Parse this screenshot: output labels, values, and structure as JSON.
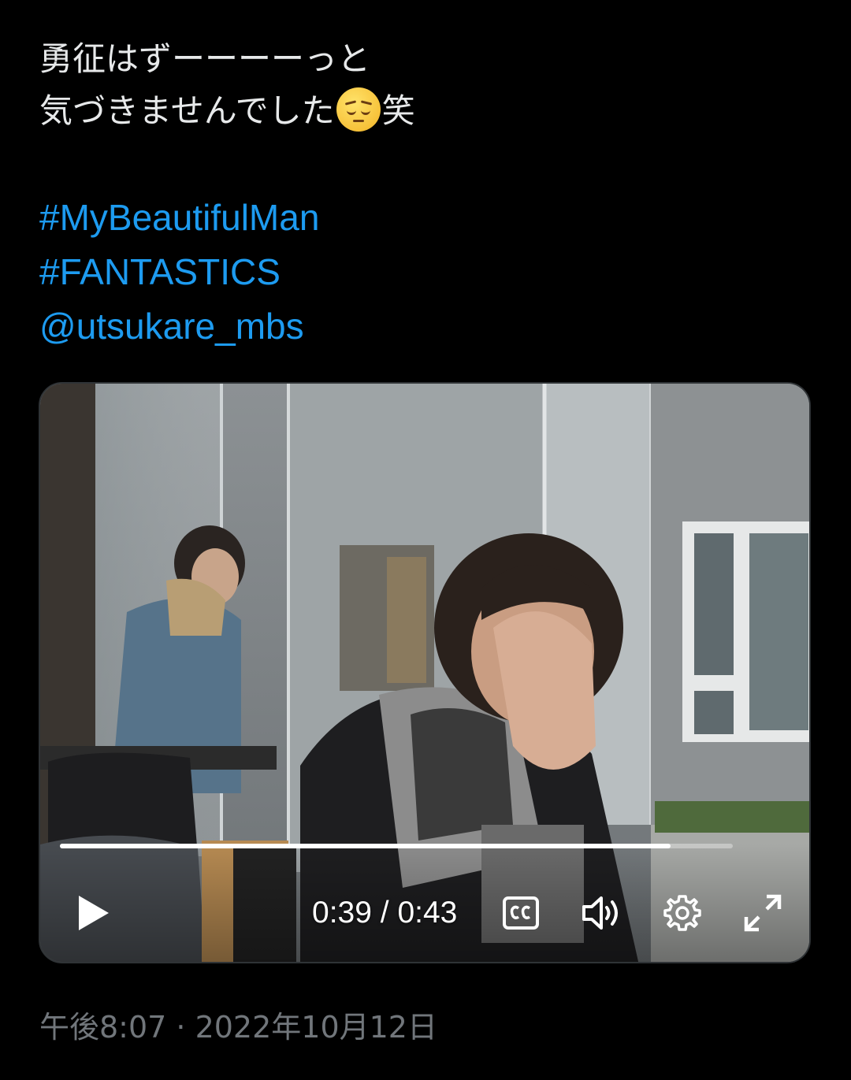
{
  "tweet": {
    "text_line1": "勇征はずーーーーっと",
    "text_line2_before": "気づきませんでした",
    "text_line2_emoji": "pensive-face-emoji",
    "text_line2_after": "笑",
    "hashtags": [
      "#MyBeautifulMan",
      "#FANTASTICS"
    ],
    "mention": "@utsukare_mbs",
    "link_color": "#1d9bf0"
  },
  "video": {
    "current_time": "0:39",
    "separator": "/",
    "duration": "0:43",
    "progress": 0.907,
    "controls": {
      "play_icon": "play-icon",
      "captions_icon": "closed-captions-icon",
      "volume_icon": "volume-icon",
      "settings_icon": "gear-icon",
      "fullscreen_icon": "fullscreen-icon"
    }
  },
  "meta": {
    "timestamp": "午後8:07 · 2022年10月12日"
  }
}
